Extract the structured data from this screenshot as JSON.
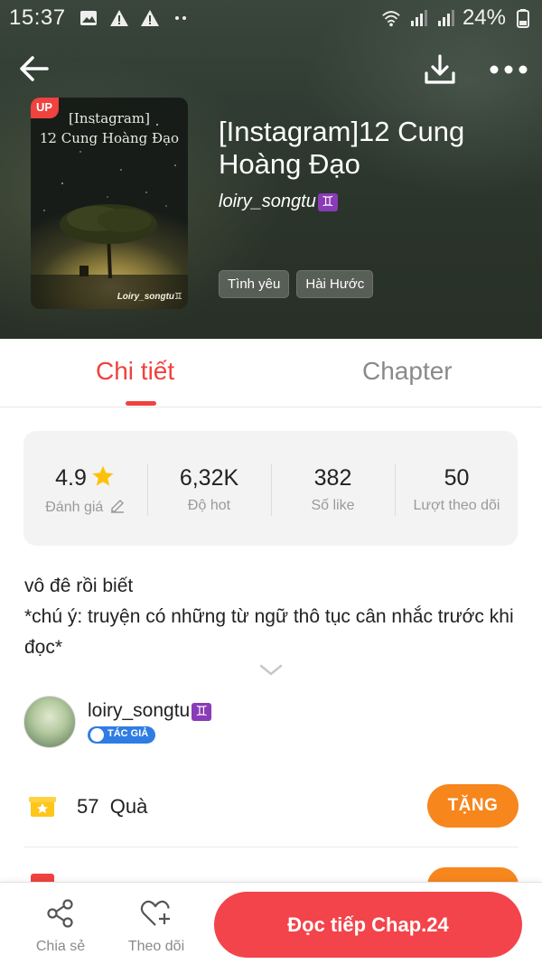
{
  "status_bar": {
    "time": "15:37",
    "battery": "24%",
    "left_icons": [
      "image-icon",
      "warning-icon",
      "warning-icon",
      "more-dots-icon"
    ],
    "right_icons": [
      "wifi-icon",
      "signal-icon",
      "signal-icon",
      "battery-icon"
    ]
  },
  "header": {
    "actions": [
      "back-arrow-icon",
      "download-icon",
      "more-options-icon"
    ]
  },
  "book": {
    "cover_badge": "UP",
    "cover_title_line1": "[Instagram]",
    "cover_title_line2": "12 Cung Hoàng Đạo",
    "cover_author": "Loiry_songtu♊",
    "title": "[Instagram]12 Cung Hoàng Đạo",
    "author": "loiry_songtu",
    "author_sign": "♊",
    "tags": [
      "Tình yêu",
      "Hài Hước"
    ]
  },
  "tabs": {
    "detail": "Chi tiết",
    "chapter": "Chapter",
    "active": "detail"
  },
  "stats": {
    "rating": {
      "value": "4.9",
      "label": "Đánh giá"
    },
    "hot": {
      "value": "6,32K",
      "label": "Độ hot"
    },
    "likes": {
      "value": "382",
      "label": "Số like"
    },
    "followers": {
      "value": "50",
      "label": "Lượt theo dõi"
    }
  },
  "description": {
    "line1": "vô đê rồi biết",
    "line2": "*chú ý: truyện có những từ ngữ thô tục cân nhắc trước khi đọc*"
  },
  "author_row": {
    "name": "loiry_songtu",
    "sign": "♊",
    "badge": "TÁC GIẢ"
  },
  "gifts": {
    "count": "57",
    "label": "Quà",
    "button": "TẶNG"
  },
  "bottom_bar": {
    "share": "Chia sẻ",
    "follow": "Theo dõi",
    "read": "Đọc tiếp Chap.24"
  },
  "colors": {
    "accent_red": "#f0423f",
    "button_orange": "#f7861c",
    "read_button": "#f2444a",
    "author_badge_blue": "#2f7de3"
  }
}
